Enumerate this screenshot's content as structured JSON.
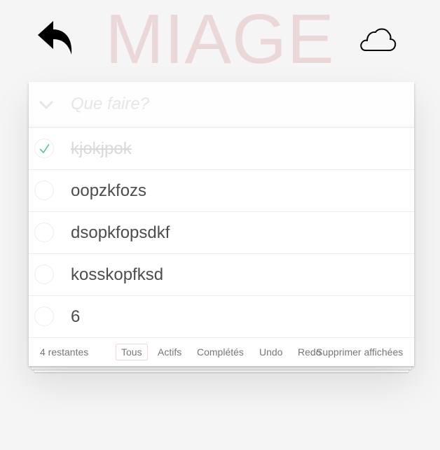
{
  "header": {
    "title": "MIAGE",
    "undo_icon": "undo-arrow-icon",
    "cloud_icon": "cloud-icon",
    "title_color": "#efd5d5"
  },
  "new_todo": {
    "placeholder": "Que faire?",
    "value": "",
    "toggle_all_icon": "chevron-down-icon"
  },
  "todos": [
    {
      "label": "kjokjpok",
      "completed": true
    },
    {
      "label": "oopzkfozs",
      "completed": false
    },
    {
      "label": "dsopkfopsdkf",
      "completed": false
    },
    {
      "label": "kosskopfksd",
      "completed": false
    },
    {
      "label": "6",
      "completed": false
    }
  ],
  "footer": {
    "count": "4 restantes",
    "filters": {
      "all": "Tous",
      "active": "Actifs",
      "completed": "Complétés",
      "undo": "Undo",
      "redo": "Redo"
    },
    "selected_filter": "Tous",
    "clear_completed": "Supprimer affichées"
  },
  "colors": {
    "background": "#f5f5f5",
    "check_mark": "#5dc2af",
    "selected_border": "#efd5d5"
  }
}
